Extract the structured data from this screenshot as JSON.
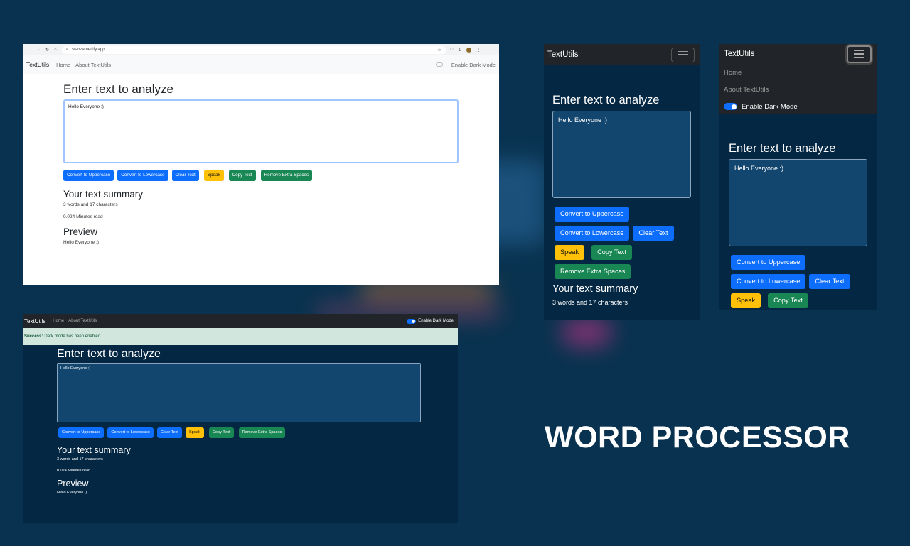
{
  "headline": "WORD PROCESSOR",
  "colors": {
    "page_bg": "#08324f",
    "dark_bg": "#042743",
    "navbar_dark": "#212529",
    "primary": "#0d6efd",
    "warning": "#ffc107",
    "success": "#198754",
    "alert_bg": "#d1e7dd"
  },
  "browser": {
    "url": "stanza.netlify.app",
    "icons": [
      "back-icon",
      "forward-icon",
      "reload-icon",
      "home-icon",
      "site-info-icon",
      "star-icon",
      "extensions-icon",
      "download-icon",
      "profile-icon",
      "kebab-menu-icon"
    ]
  },
  "light": {
    "brand": "TextUtils",
    "nav_home": "Home",
    "nav_about": "About TextUtils",
    "dark_mode_label": "Enable Dark Mode",
    "heading": "Enter text to analyze",
    "textarea_value": "Hello Everyone :)",
    "buttons": {
      "upper": "Convert to Uppercase",
      "lower": "Convert to Lowercase",
      "clear": "Clear Text",
      "speak": "Speak",
      "copy": "Copy Text",
      "spaces": "Remove Extra Spaces"
    },
    "summary_heading": "Your text summary",
    "summary_counts": "3 words and 17 characters",
    "summary_read": "0.024 Minutes read",
    "preview_heading": "Preview",
    "preview_text": "Hello Everyone :)"
  },
  "dark": {
    "brand": "TextUtils",
    "nav_home": "Home",
    "nav_about": "About TextUtils",
    "dark_mode_label": "Enable Dark Mode",
    "alert_strong": "Success:",
    "alert_text": "Dark mode has been enabled",
    "heading": "Enter text to analyze",
    "textarea_value": "Hello Everyone :)",
    "buttons": {
      "upper": "Convert to Uppercase",
      "lower": "Convert to Lowercase",
      "clear": "Clear Text",
      "speak": "Speak",
      "copy": "Copy Text",
      "spaces": "Remove Extra Spaces"
    },
    "summary_heading": "Your text summary",
    "summary_counts": "3 words and 17 characters",
    "summary_read": "0.024 Minutes read",
    "preview_heading": "Preview",
    "preview_text": "Hello Everyone :)"
  },
  "mobile_collapsed": {
    "brand": "TextUtils",
    "heading": "Enter text to analyze",
    "textarea_value": "Hello Everyone :)",
    "buttons": {
      "upper": "Convert to Uppercase",
      "lower": "Convert to Lowercase",
      "clear": "Clear Text",
      "speak": "Speak",
      "copy": "Copy Text",
      "spaces": "Remove Extra Spaces"
    },
    "summary_heading": "Your text summary",
    "summary_counts": "3 words and 17 characters"
  },
  "mobile_expanded": {
    "brand": "TextUtils",
    "nav_home": "Home",
    "nav_about": "About TextUtils",
    "dark_mode_label": "Enable Dark Mode",
    "heading": "Enter text to analyze",
    "textarea_value": "Hello Everyone :)",
    "buttons": {
      "upper": "Convert to Uppercase",
      "lower": "Convert to Lowercase",
      "clear": "Clear Text",
      "speak": "Speak",
      "copy": "Copy Text"
    }
  }
}
